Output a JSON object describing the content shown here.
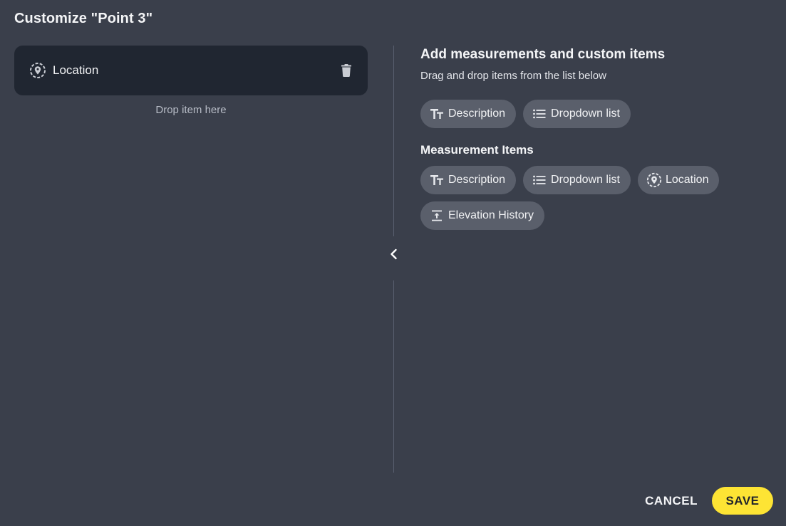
{
  "dialog": {
    "title": "Customize \"Point 3\""
  },
  "left_panel": {
    "selected_items": [
      {
        "label": "Location",
        "icon": "location-pin-icon"
      }
    ],
    "drop_hint": "Drop item here"
  },
  "right_panel": {
    "heading": "Add measurements and custom items",
    "subheading": "Drag and drop items from the list below",
    "custom_items": [
      {
        "label": "Description",
        "icon": "text-format-icon"
      },
      {
        "label": "Dropdown list",
        "icon": "list-icon"
      }
    ],
    "measurement_heading": "Measurement Items",
    "measurement_items": [
      {
        "label": "Description",
        "icon": "text-format-icon"
      },
      {
        "label": "Dropdown list",
        "icon": "list-icon"
      },
      {
        "label": "Location",
        "icon": "location-pin-icon"
      },
      {
        "label": "Elevation History",
        "icon": "elevation-icon"
      }
    ]
  },
  "footer": {
    "cancel_label": "CANCEL",
    "save_label": "SAVE"
  },
  "colors": {
    "background": "#3a3f4b",
    "selected_item_bg": "#202631",
    "chip_bg": "#5a5f6b",
    "accent": "#fde434"
  }
}
